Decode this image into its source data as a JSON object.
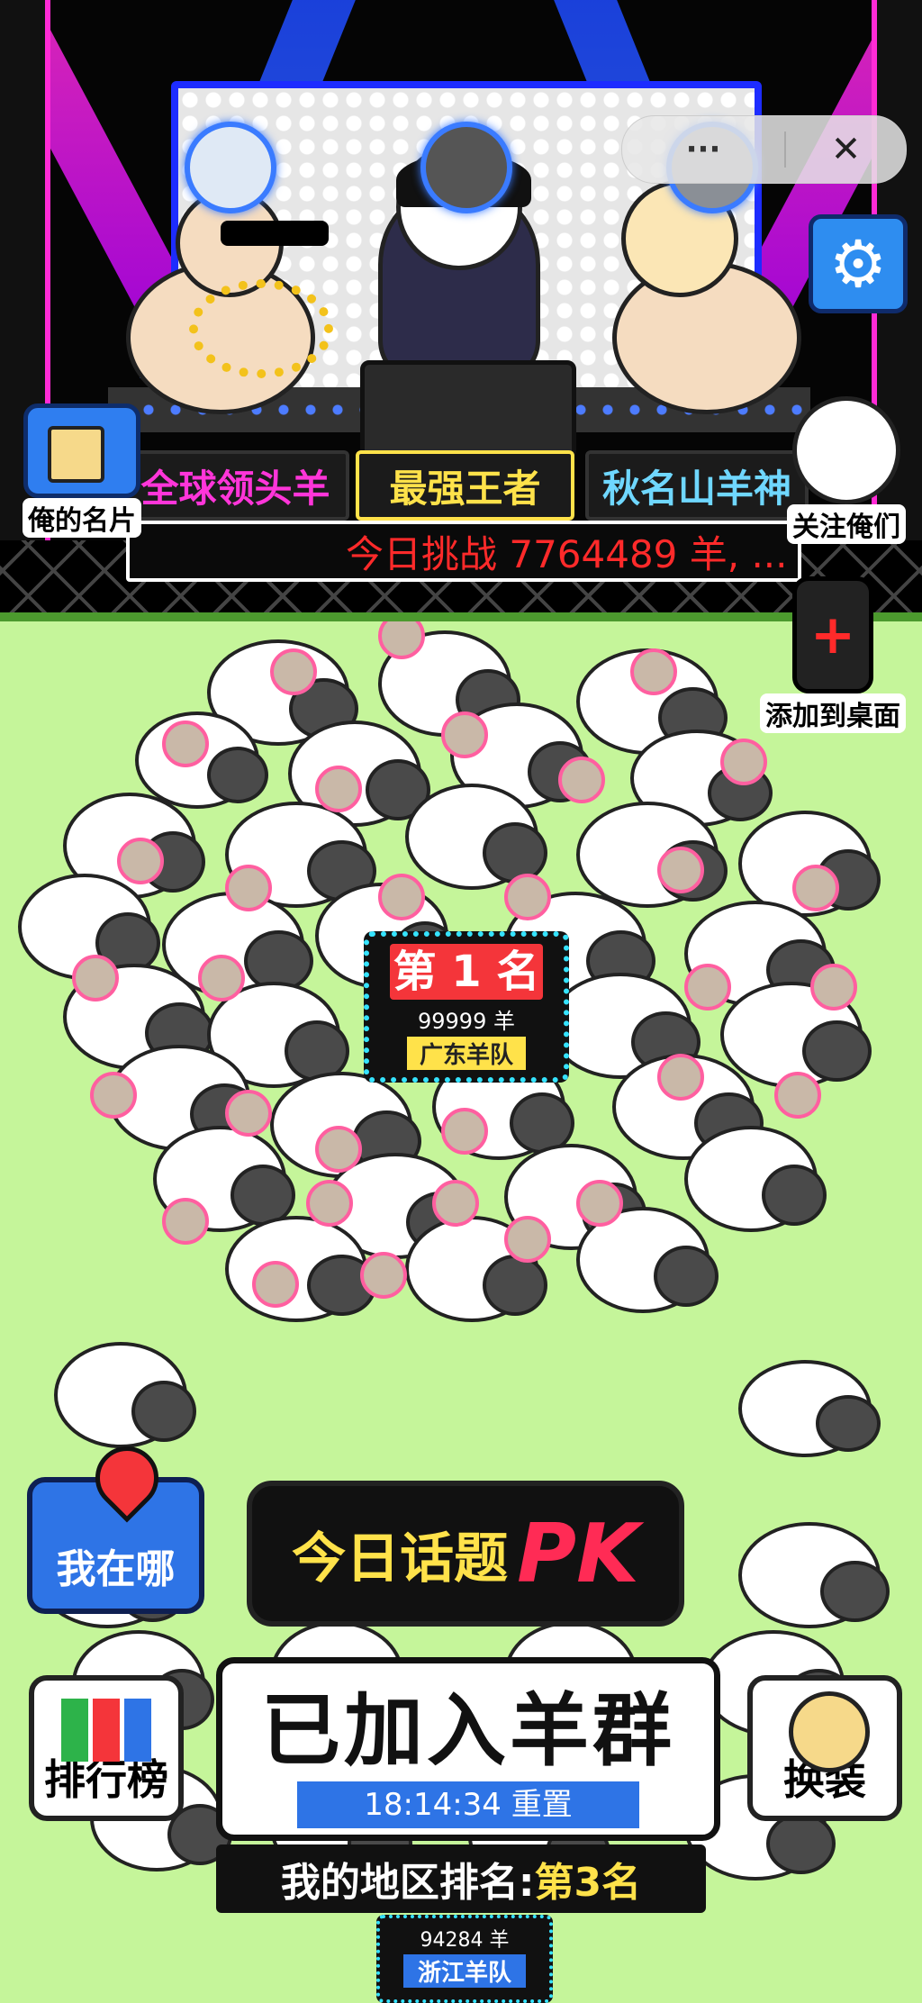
{
  "stage": {
    "signs": {
      "left": "全球领头羊",
      "center": "最强王者",
      "right": "秋名山羊神"
    },
    "ticker": "今日挑战 7764489 羊, ..."
  },
  "capsule": {
    "more_icon": "more-dots-icon",
    "more": "···",
    "close_icon": "close-icon",
    "close": "✕"
  },
  "side_buttons": {
    "settings_icon": "gear-icon",
    "settings_glyph": "⚙",
    "my_card": "俺的名片",
    "follow_us": "关注俺们",
    "add_to_desktop": "添加到桌面",
    "add_glyph": "+"
  },
  "rank_badge": {
    "title": "第 1 名",
    "score": "99999 羊",
    "team": "广东羊队"
  },
  "hud": {
    "where_am_i": "我在哪",
    "topic_label": "今日话题",
    "topic_pk": "PK",
    "leaderboard": "排行榜",
    "joined": "已加入羊群",
    "reset_timer": "18:14:34 重置",
    "dress_up": "换装",
    "region_rank_label": "我的地区排名:",
    "region_rank_value": "第3名",
    "mini_score": "94284 羊",
    "mini_team": "浙江羊队"
  },
  "colors": {
    "accent_blue": "#2e74e6",
    "accent_red": "#f4353a",
    "accent_yellow": "#ffe24a",
    "grass": "#c5f59a"
  }
}
